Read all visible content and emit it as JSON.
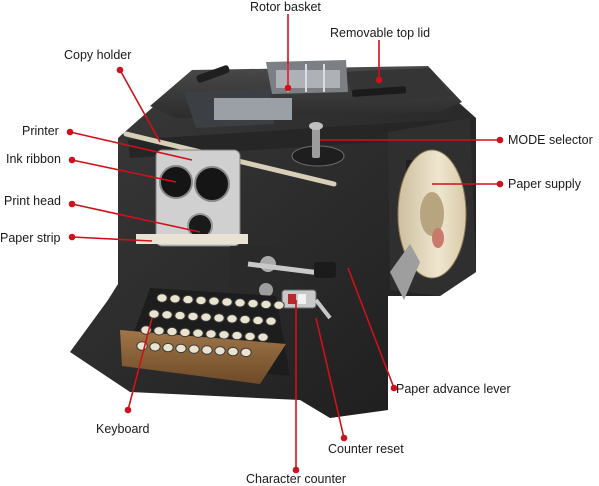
{
  "labels": {
    "rotor_basket": "Rotor basket",
    "removable_top_lid": "Removable top lid",
    "copy_holder": "Copy holder",
    "printer": "Printer",
    "ink_ribbon": "Ink ribbon",
    "print_head": "Print head",
    "paper_strip": "Paper strip",
    "mode_selector": "MODE selector",
    "paper_supply": "Paper supply",
    "paper_advance_lever": "Paper advance lever",
    "keyboard": "Keyboard",
    "counter_reset": "Counter reset",
    "character_counter": "Character counter"
  },
  "colors": {
    "leader": "#d0101b",
    "body": "#2a2a2a",
    "text": "#1a1a1a"
  }
}
